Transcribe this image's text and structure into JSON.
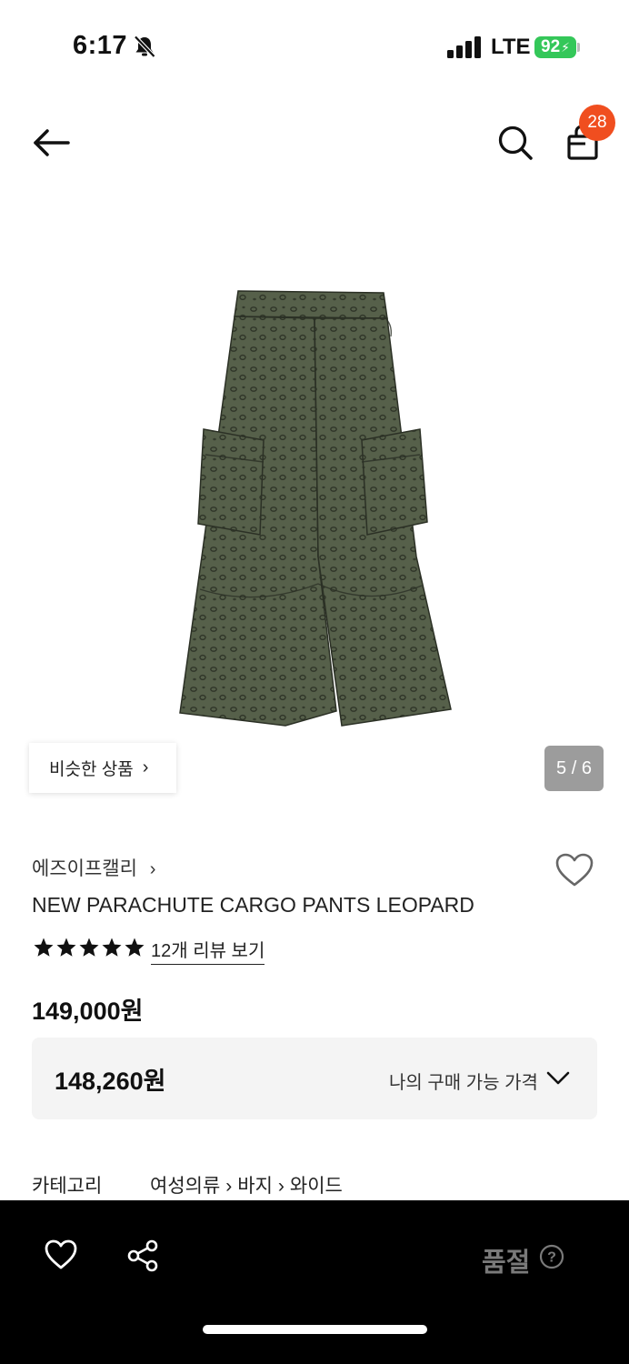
{
  "status_bar": {
    "time": "6:17",
    "network": "LTE",
    "battery": "92"
  },
  "header": {
    "cart_count": "28"
  },
  "gallery": {
    "similar_label": "비슷한 상품",
    "page_indicator": "5 / 6"
  },
  "product": {
    "brand": "에즈이프캘리",
    "title": "NEW PARACHUTE CARGO PANTS LEOPARD",
    "rating_stars": 5,
    "review_link": "12개 리뷰 보기",
    "price": "149,000원",
    "my_price": "148,260원",
    "my_price_label": "나의 구매 가능 가격"
  },
  "category": {
    "label": "카테고리",
    "path": [
      "여성의류",
      "바지",
      "와이드"
    ]
  },
  "bottom_bar": {
    "status_label": "품절"
  },
  "colors": {
    "accent": "#f04e1f",
    "battery": "#34c759",
    "bottom_bar": "#000000",
    "product": "#4c5542"
  }
}
